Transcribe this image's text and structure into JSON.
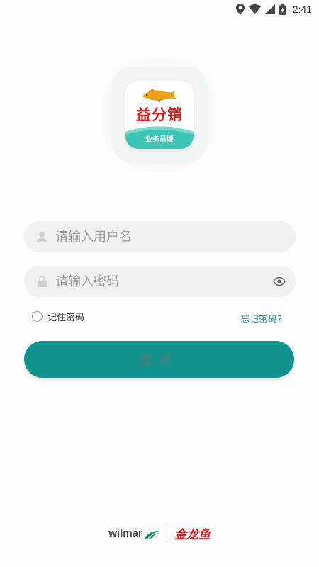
{
  "status_bar": {
    "time": "2:41"
  },
  "app_icon": {
    "brand": "益分销",
    "edition": "业务员版",
    "colors": {
      "brand_red": "#e11919",
      "band_teal": "#3cc4b4"
    }
  },
  "login_form": {
    "username_placeholder": "请输入用户名",
    "password_placeholder": "请输入密码",
    "remember_label": "记住密码",
    "forgot_label": "忘记密码?",
    "login_label": "登录",
    "accent_color": "#12938f"
  },
  "footer": {
    "wilmar_label": "wilmar",
    "jinlongyu_label": "金龙鱼"
  }
}
